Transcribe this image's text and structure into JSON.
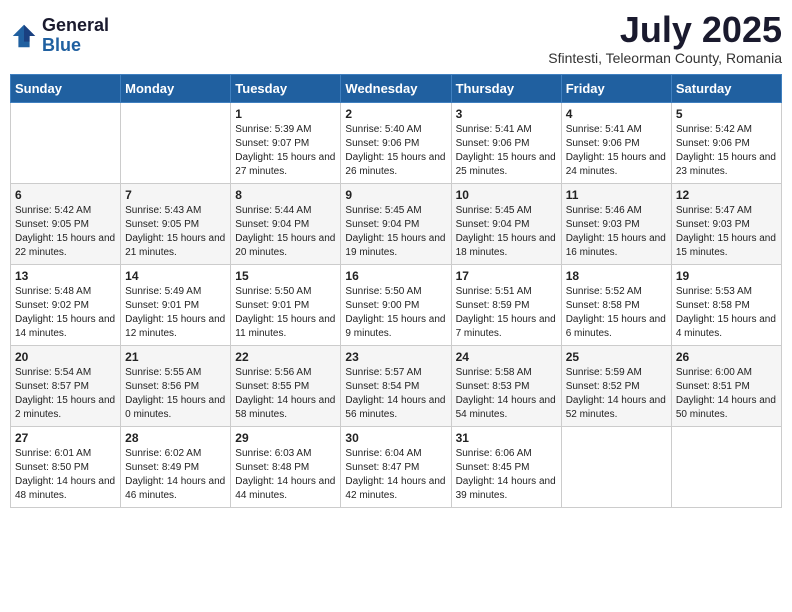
{
  "logo": {
    "general": "General",
    "blue": "Blue"
  },
  "title": {
    "month_year": "July 2025",
    "location": "Sfintesti, Teleorman County, Romania"
  },
  "header_days": [
    "Sunday",
    "Monday",
    "Tuesday",
    "Wednesday",
    "Thursday",
    "Friday",
    "Saturday"
  ],
  "weeks": [
    [
      {
        "day": "",
        "info": ""
      },
      {
        "day": "",
        "info": ""
      },
      {
        "day": "1",
        "sunrise": "Sunrise: 5:39 AM",
        "sunset": "Sunset: 9:07 PM",
        "daylight": "Daylight: 15 hours and 27 minutes."
      },
      {
        "day": "2",
        "sunrise": "Sunrise: 5:40 AM",
        "sunset": "Sunset: 9:06 PM",
        "daylight": "Daylight: 15 hours and 26 minutes."
      },
      {
        "day": "3",
        "sunrise": "Sunrise: 5:41 AM",
        "sunset": "Sunset: 9:06 PM",
        "daylight": "Daylight: 15 hours and 25 minutes."
      },
      {
        "day": "4",
        "sunrise": "Sunrise: 5:41 AM",
        "sunset": "Sunset: 9:06 PM",
        "daylight": "Daylight: 15 hours and 24 minutes."
      },
      {
        "day": "5",
        "sunrise": "Sunrise: 5:42 AM",
        "sunset": "Sunset: 9:06 PM",
        "daylight": "Daylight: 15 hours and 23 minutes."
      }
    ],
    [
      {
        "day": "6",
        "sunrise": "Sunrise: 5:42 AM",
        "sunset": "Sunset: 9:05 PM",
        "daylight": "Daylight: 15 hours and 22 minutes."
      },
      {
        "day": "7",
        "sunrise": "Sunrise: 5:43 AM",
        "sunset": "Sunset: 9:05 PM",
        "daylight": "Daylight: 15 hours and 21 minutes."
      },
      {
        "day": "8",
        "sunrise": "Sunrise: 5:44 AM",
        "sunset": "Sunset: 9:04 PM",
        "daylight": "Daylight: 15 hours and 20 minutes."
      },
      {
        "day": "9",
        "sunrise": "Sunrise: 5:45 AM",
        "sunset": "Sunset: 9:04 PM",
        "daylight": "Daylight: 15 hours and 19 minutes."
      },
      {
        "day": "10",
        "sunrise": "Sunrise: 5:45 AM",
        "sunset": "Sunset: 9:04 PM",
        "daylight": "Daylight: 15 hours and 18 minutes."
      },
      {
        "day": "11",
        "sunrise": "Sunrise: 5:46 AM",
        "sunset": "Sunset: 9:03 PM",
        "daylight": "Daylight: 15 hours and 16 minutes."
      },
      {
        "day": "12",
        "sunrise": "Sunrise: 5:47 AM",
        "sunset": "Sunset: 9:03 PM",
        "daylight": "Daylight: 15 hours and 15 minutes."
      }
    ],
    [
      {
        "day": "13",
        "sunrise": "Sunrise: 5:48 AM",
        "sunset": "Sunset: 9:02 PM",
        "daylight": "Daylight: 15 hours and 14 minutes."
      },
      {
        "day": "14",
        "sunrise": "Sunrise: 5:49 AM",
        "sunset": "Sunset: 9:01 PM",
        "daylight": "Daylight: 15 hours and 12 minutes."
      },
      {
        "day": "15",
        "sunrise": "Sunrise: 5:50 AM",
        "sunset": "Sunset: 9:01 PM",
        "daylight": "Daylight: 15 hours and 11 minutes."
      },
      {
        "day": "16",
        "sunrise": "Sunrise: 5:50 AM",
        "sunset": "Sunset: 9:00 PM",
        "daylight": "Daylight: 15 hours and 9 minutes."
      },
      {
        "day": "17",
        "sunrise": "Sunrise: 5:51 AM",
        "sunset": "Sunset: 8:59 PM",
        "daylight": "Daylight: 15 hours and 7 minutes."
      },
      {
        "day": "18",
        "sunrise": "Sunrise: 5:52 AM",
        "sunset": "Sunset: 8:58 PM",
        "daylight": "Daylight: 15 hours and 6 minutes."
      },
      {
        "day": "19",
        "sunrise": "Sunrise: 5:53 AM",
        "sunset": "Sunset: 8:58 PM",
        "daylight": "Daylight: 15 hours and 4 minutes."
      }
    ],
    [
      {
        "day": "20",
        "sunrise": "Sunrise: 5:54 AM",
        "sunset": "Sunset: 8:57 PM",
        "daylight": "Daylight: 15 hours and 2 minutes."
      },
      {
        "day": "21",
        "sunrise": "Sunrise: 5:55 AM",
        "sunset": "Sunset: 8:56 PM",
        "daylight": "Daylight: 15 hours and 0 minutes."
      },
      {
        "day": "22",
        "sunrise": "Sunrise: 5:56 AM",
        "sunset": "Sunset: 8:55 PM",
        "daylight": "Daylight: 14 hours and 58 minutes."
      },
      {
        "day": "23",
        "sunrise": "Sunrise: 5:57 AM",
        "sunset": "Sunset: 8:54 PM",
        "daylight": "Daylight: 14 hours and 56 minutes."
      },
      {
        "day": "24",
        "sunrise": "Sunrise: 5:58 AM",
        "sunset": "Sunset: 8:53 PM",
        "daylight": "Daylight: 14 hours and 54 minutes."
      },
      {
        "day": "25",
        "sunrise": "Sunrise: 5:59 AM",
        "sunset": "Sunset: 8:52 PM",
        "daylight": "Daylight: 14 hours and 52 minutes."
      },
      {
        "day": "26",
        "sunrise": "Sunrise: 6:00 AM",
        "sunset": "Sunset: 8:51 PM",
        "daylight": "Daylight: 14 hours and 50 minutes."
      }
    ],
    [
      {
        "day": "27",
        "sunrise": "Sunrise: 6:01 AM",
        "sunset": "Sunset: 8:50 PM",
        "daylight": "Daylight: 14 hours and 48 minutes."
      },
      {
        "day": "28",
        "sunrise": "Sunrise: 6:02 AM",
        "sunset": "Sunset: 8:49 PM",
        "daylight": "Daylight: 14 hours and 46 minutes."
      },
      {
        "day": "29",
        "sunrise": "Sunrise: 6:03 AM",
        "sunset": "Sunset: 8:48 PM",
        "daylight": "Daylight: 14 hours and 44 minutes."
      },
      {
        "day": "30",
        "sunrise": "Sunrise: 6:04 AM",
        "sunset": "Sunset: 8:47 PM",
        "daylight": "Daylight: 14 hours and 42 minutes."
      },
      {
        "day": "31",
        "sunrise": "Sunrise: 6:06 AM",
        "sunset": "Sunset: 8:45 PM",
        "daylight": "Daylight: 14 hours and 39 minutes."
      },
      {
        "day": "",
        "info": ""
      },
      {
        "day": "",
        "info": ""
      }
    ]
  ]
}
